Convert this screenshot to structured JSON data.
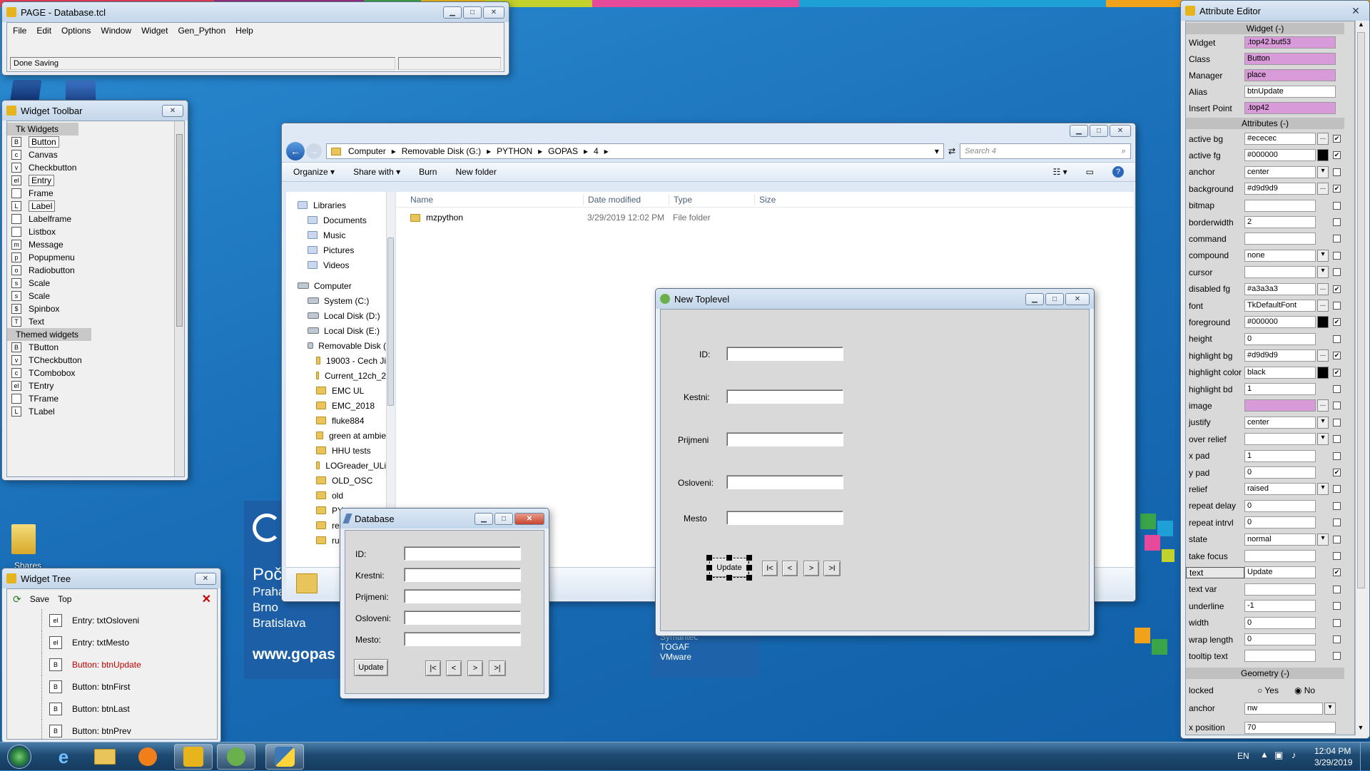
{
  "page_main": {
    "title": "PAGE - Database.tcl",
    "menu": [
      "File",
      "Edit",
      "Options",
      "Window",
      "Widget",
      "Gen_Python",
      "Help"
    ],
    "status": "Done Saving"
  },
  "desktop": {
    "shares_label": "Shares",
    "banner_title": "Poč",
    "banner_cities": [
      "Praha",
      "Brno",
      "Bratislava"
    ],
    "banner_url": "www.gopas",
    "course_list": [
      "Symantec",
      "TOGAF",
      "VMware"
    ]
  },
  "widget_toolbar": {
    "title": "Widget Toolbar",
    "tk_header": "Tk Widgets",
    "tk_items": [
      {
        "label": "Button",
        "icon": "B"
      },
      {
        "label": "Canvas",
        "icon": "c"
      },
      {
        "label": "Checkbutton",
        "icon": "v"
      },
      {
        "label": "Entry",
        "icon": "el"
      },
      {
        "label": "Frame",
        "icon": ""
      },
      {
        "label": "Label",
        "icon": "L"
      },
      {
        "label": "Labelframe",
        "icon": ""
      },
      {
        "label": "Listbox",
        "icon": ""
      },
      {
        "label": "Message",
        "icon": "m"
      },
      {
        "label": "Popupmenu",
        "icon": "p"
      },
      {
        "label": "Radiobutton",
        "icon": "o"
      },
      {
        "label": "Scale",
        "icon": "s"
      },
      {
        "label": "Scale",
        "icon": "s"
      },
      {
        "label": "Spinbox",
        "icon": "$"
      },
      {
        "label": "Text",
        "icon": "T"
      }
    ],
    "themed_header": "Themed widgets",
    "themed_items": [
      {
        "label": "TButton",
        "icon": "B"
      },
      {
        "label": "TCheckbutton",
        "icon": "v"
      },
      {
        "label": "TCombobox",
        "icon": "c"
      },
      {
        "label": "TEntry",
        "icon": "el"
      },
      {
        "label": "TFrame",
        "icon": ""
      },
      {
        "label": "TLabel",
        "icon": "L"
      }
    ]
  },
  "widget_tree": {
    "title": "Widget Tree",
    "save": "Save",
    "top": "Top",
    "items": [
      {
        "icon": "el",
        "label": "Entry: txtOsloveni",
        "selected": false
      },
      {
        "icon": "el",
        "label": "Entry: txtMesto",
        "selected": false
      },
      {
        "icon": "B",
        "label": "Button: btnUpdate",
        "selected": true
      },
      {
        "icon": "B",
        "label": "Button: btnFirst",
        "selected": false
      },
      {
        "icon": "B",
        "label": "Button: btnLast",
        "selected": false
      },
      {
        "icon": "B",
        "label": "Button: btnPrev",
        "selected": false
      }
    ]
  },
  "explorer": {
    "breadcrumb": [
      "Computer",
      "Removable Disk (G:)",
      "PYTHON",
      "GOPAS",
      "4"
    ],
    "search_placeholder": "Search 4",
    "commands": [
      "Organize",
      "Share with",
      "Burn",
      "New folder"
    ],
    "columns": [
      "Name",
      "Date modified",
      "Type",
      "Size"
    ],
    "files": [
      {
        "name": "mzpython",
        "date": "3/29/2019 12:02 PM",
        "type": "File folder",
        "size": ""
      }
    ],
    "nav_libraries": "Libraries",
    "nav_lib_items": [
      "Documents",
      "Music",
      "Pictures",
      "Videos"
    ],
    "nav_computer": "Computer",
    "nav_drives": [
      "System (C:)",
      "Local Disk (D:)",
      "Local Disk (E:)",
      "Removable Disk ("
    ],
    "nav_folders": [
      "19003 - Cech Ji",
      "Current_12ch_2",
      "EMC UL",
      "EMC_2018",
      "fluke884",
      "green at ambie",
      "HHU tests",
      "LOGreader_ULi",
      "OLD_OSC",
      "old",
      "PY",
      "red",
      "run"
    ]
  },
  "toplevel": {
    "title": "New Toplevel",
    "labels": [
      "ID:",
      "Kestni:",
      "Prijmeni",
      "Osloveni:",
      "Mesto"
    ],
    "update": "Update",
    "nav_buttons": [
      "I<",
      "<",
      ">",
      ">I"
    ]
  },
  "database": {
    "title": "Database",
    "labels": [
      "ID:",
      "Krestni:",
      "Prijmeni:",
      "Osloveni:",
      "Mesto:"
    ],
    "update": "Update",
    "nav_buttons": [
      "|<",
      "<",
      ">",
      ">|"
    ]
  },
  "attribute_editor": {
    "title": "Attribute Editor",
    "widget_header": "Widget (-)",
    "widget_rows": [
      {
        "name": "Widget",
        "value": ".top42.but53",
        "pink": true
      },
      {
        "name": "Class",
        "value": "Button",
        "pink": true
      },
      {
        "name": "Manager",
        "value": "place",
        "pink": true
      },
      {
        "name": "Alias",
        "value": "btnUpdate",
        "pink": false
      },
      {
        "name": "Insert Point",
        "value": ".top42",
        "pink": true
      }
    ],
    "attr_header": "Attributes (-)",
    "attrs": [
      {
        "name": "active bg",
        "value": "#ececec",
        "btn": "...",
        "checked": true
      },
      {
        "name": "active fg",
        "value": "#000000",
        "btn": "dark",
        "checked": true
      },
      {
        "name": "anchor",
        "value": "center",
        "btn": "drop",
        "checked": false
      },
      {
        "name": "background",
        "value": "#d9d9d9",
        "btn": "...",
        "checked": true
      },
      {
        "name": "bitmap",
        "value": "",
        "btn": "",
        "checked": false
      },
      {
        "name": "borderwidth",
        "value": "2",
        "btn": "",
        "checked": false
      },
      {
        "name": "command",
        "value": "",
        "btn": "",
        "checked": false
      },
      {
        "name": "compound",
        "value": "none",
        "btn": "drop",
        "checked": false
      },
      {
        "name": "cursor",
        "value": "",
        "btn": "drop",
        "checked": false
      },
      {
        "name": "disabled fg",
        "value": "#a3a3a3",
        "btn": "...",
        "checked": true
      },
      {
        "name": "font",
        "value": "TkDefaultFont",
        "btn": "...",
        "checked": false
      },
      {
        "name": "foreground",
        "value": "#000000",
        "btn": "dark",
        "checked": true
      },
      {
        "name": "height",
        "value": "0",
        "btn": "",
        "checked": false
      },
      {
        "name": "highlight bg",
        "value": "#d9d9d9",
        "btn": "...",
        "checked": true
      },
      {
        "name": "highlight color",
        "value": "black",
        "btn": "dark",
        "checked": true
      },
      {
        "name": "highlight bd",
        "value": "1",
        "btn": "",
        "checked": false
      },
      {
        "name": "image",
        "value": "",
        "btn": "...",
        "checked": false,
        "pink": true
      },
      {
        "name": "justify",
        "value": "center",
        "btn": "drop",
        "checked": false
      },
      {
        "name": "over relief",
        "value": "",
        "btn": "drop",
        "checked": false
      },
      {
        "name": "x pad",
        "value": "1",
        "btn": "",
        "checked": false
      },
      {
        "name": "y pad",
        "value": "0",
        "btn": "",
        "checked": true
      },
      {
        "name": "relief",
        "value": "raised",
        "btn": "drop",
        "checked": false
      },
      {
        "name": "repeat delay",
        "value": "0",
        "btn": "",
        "checked": false
      },
      {
        "name": "repeat intrvl",
        "value": "0",
        "btn": "",
        "checked": false
      },
      {
        "name": "state",
        "value": "normal",
        "btn": "drop",
        "checked": false
      },
      {
        "name": "take focus",
        "value": "",
        "btn": "",
        "checked": false
      },
      {
        "name": "text",
        "value": "Update",
        "btn": "",
        "checked": true
      },
      {
        "name": "text var",
        "value": "",
        "btn": "",
        "checked": false
      },
      {
        "name": "underline",
        "value": "-1",
        "btn": "",
        "checked": false
      },
      {
        "name": "width",
        "value": "0",
        "btn": "",
        "checked": false
      },
      {
        "name": "wrap length",
        "value": "0",
        "btn": "",
        "checked": false
      },
      {
        "name": "tooltip text",
        "value": "",
        "btn": "",
        "checked": false
      }
    ],
    "geometry_header": "Geometry (-)",
    "locked_label": "locked",
    "locked_yes": "Yes",
    "locked_no": "No",
    "geo_anchor_label": "anchor",
    "geo_anchor_value": "nw",
    "xpos_label": "x position",
    "xpos_value": "70"
  },
  "taskbar": {
    "lang": "EN",
    "time": "12:04 PM",
    "date": "3/29/2019"
  },
  "colors": {
    "accent_pink": "#d99ad9",
    "selected_red": "#c00000",
    "stripe": [
      "#e63d5a",
      "#9a2f83",
      "#3aa548",
      "#e7b51b",
      "#2a8ad0",
      "#c2d12c",
      "#e74a9b",
      "#1ea0d6",
      "#f0a21a"
    ]
  }
}
